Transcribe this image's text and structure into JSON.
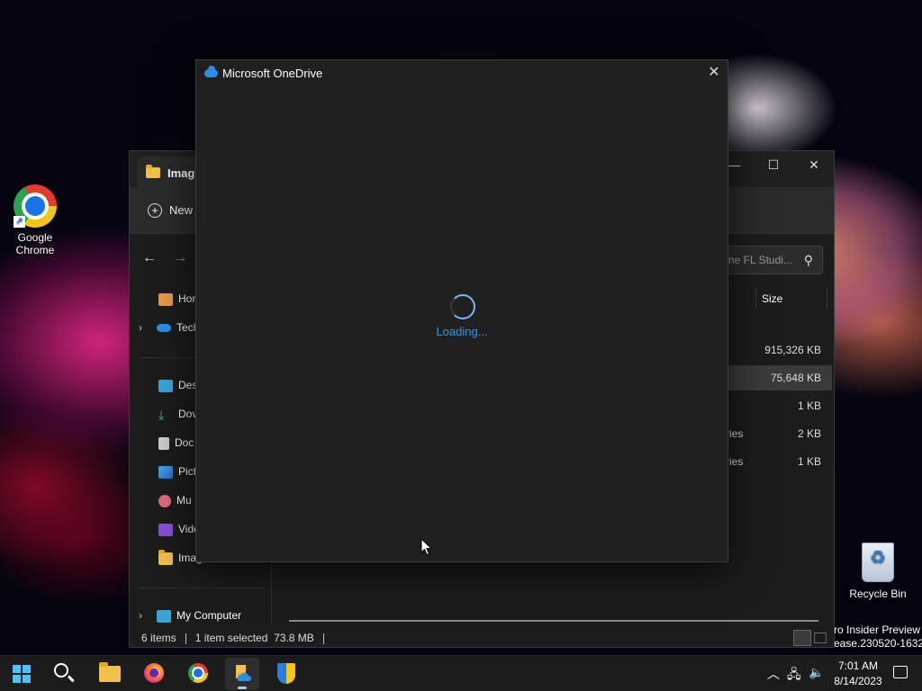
{
  "desktop": {
    "icons": {
      "chrome": "Google Chrome",
      "recycle_bin": "Recycle Bin"
    },
    "watermark": {
      "line1": "ro Insider Preview",
      "line2": "ease.230520-1632"
    }
  },
  "explorer": {
    "tab_title": "Image",
    "toolbar": {
      "new_label": "New"
    },
    "search_placeholder": "ne FL Studi...",
    "nav": {
      "home": "Hor",
      "onedrive": "Tecl",
      "desktop": "Des",
      "downloads": "Dov",
      "documents": "Doc",
      "pictures": "Pict",
      "music": "Mu",
      "videos": "Vide",
      "images": "Imag",
      "my_computer": "My Computer"
    },
    "columns": {
      "size": "Size"
    },
    "rows": [
      {
        "type": "",
        "size": "915,326 KB",
        "selected": false
      },
      {
        "type": "",
        "size": "75,648 KB",
        "selected": true
      },
      {
        "type": "",
        "size": "1 KB",
        "selected": false
      },
      {
        "type": "ries",
        "size": "2 KB",
        "selected": false
      },
      {
        "type": "ries",
        "size": "1 KB",
        "selected": false
      }
    ],
    "status": {
      "items": "6 items",
      "selected": "1 item selected",
      "size": "73.8 MB"
    }
  },
  "onedrive_dialog": {
    "title": "Microsoft OneDrive",
    "loading_text": "Loading..."
  },
  "taskbar": {
    "clock_time": "7:01 AM",
    "clock_date": "8/14/2023"
  },
  "colors": {
    "accent": "#3b96e8",
    "onedrive_blue": "#2d8ee5",
    "dialog_bg": "#202020",
    "taskbar_bg": "#1c1c1c"
  }
}
